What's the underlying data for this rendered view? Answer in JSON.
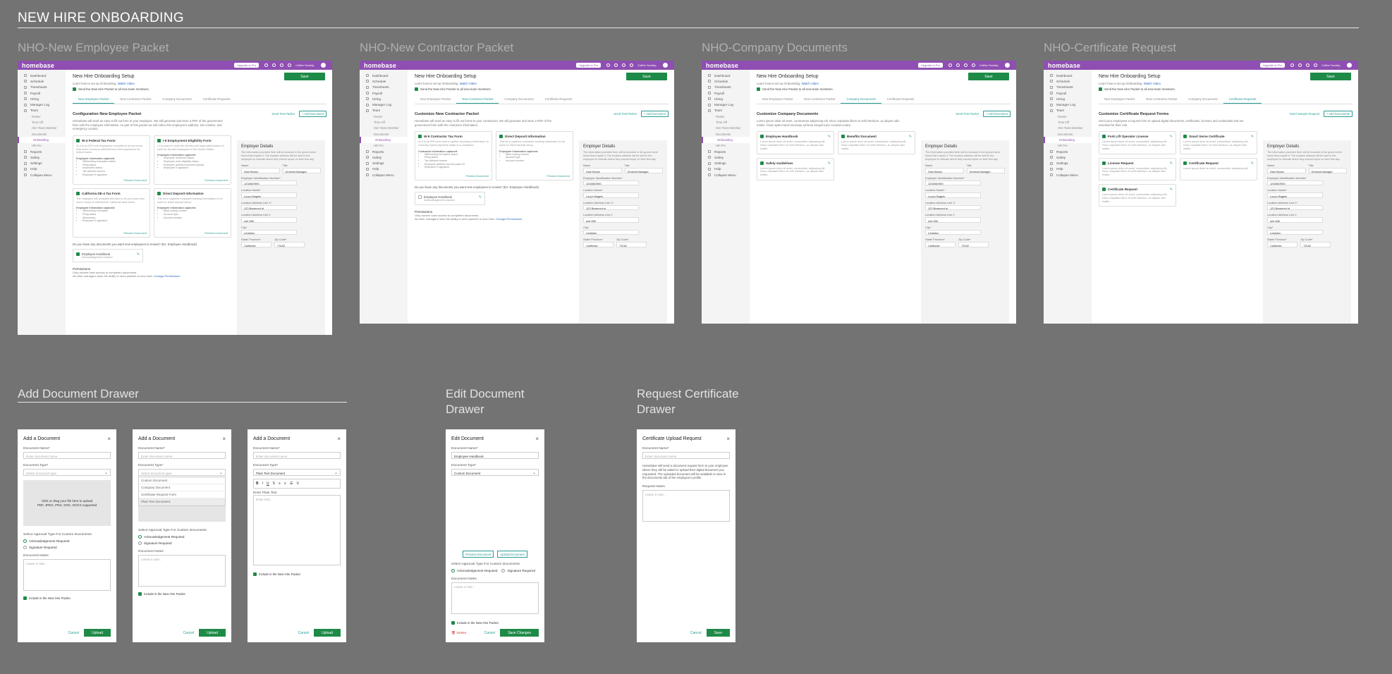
{
  "page_title": "NEW HIRE ONBOARDING",
  "colors": {
    "brand": "#8f4fb2",
    "primary": "#1e8a48",
    "link": "#2a9c95",
    "danger": "#d14a3b",
    "canvas": "#737373"
  },
  "sections": {
    "nho_employee": "NHO-New Employee Packet",
    "nho_contractor": "NHO-New Contractor Packet",
    "nho_company": "NHO-Company Documents",
    "nho_certificate": "NHO-Certificate Request",
    "add_doc": "Add Document Drawer",
    "edit_doc": "Edit Document Drawer",
    "request_cert": "Request Certificate Drawer"
  },
  "app": {
    "logo": "homebase",
    "upgrade": "Upgrade to Pro",
    "account": "Coffee Society..",
    "icons": [
      "clock-icon",
      "chat-icon",
      "bell-icon",
      "help-icon"
    ],
    "nav": [
      {
        "label": "Dashboard",
        "icon": "dashboard-icon"
      },
      {
        "label": "Schedule",
        "icon": "calendar-icon"
      },
      {
        "label": "Timesheets",
        "icon": "clock-icon"
      },
      {
        "label": "Payroll",
        "icon": "dollar-icon"
      },
      {
        "label": "Hiring",
        "icon": "briefcase-icon"
      },
      {
        "label": "Manager Log",
        "icon": "book-icon"
      },
      {
        "label": "Team",
        "icon": "team-icon"
      }
    ],
    "team_sub": [
      "Roster",
      "Time Off",
      "Hire Team Member",
      "Documents",
      "Onboarding",
      "HR Pro"
    ],
    "nav2": [
      {
        "label": "Reports",
        "icon": "chart-icon"
      },
      {
        "label": "Safety",
        "icon": "shield-icon"
      },
      {
        "label": "Settings",
        "icon": "gear-icon"
      },
      {
        "label": "Help",
        "icon": "help-icon"
      },
      {
        "label": "Collapse Menu",
        "icon": "collapse-icon"
      }
    ],
    "title": "New Hire Onboarding Setup",
    "save": "Save",
    "learn": "Learn how to set up Onboarding.",
    "watch": "Watch Video",
    "send_new": "Send the New Hire Packet to all new team members.",
    "tabs": [
      "New Employee Packet",
      "New Contractor Packet",
      "Company Documents",
      "Certificate Requests"
    ],
    "send_test": "Send Test Packet",
    "add_document": "+ Add Document",
    "send_sample": "Send Sample Request",
    "add_documents": "+ Add Documents",
    "preview": "Preview Document",
    "docs_question": "Do you have any documents you want new employees to review? (Ex: Employee Handbook)",
    "docs_question_c": "Do you have any documents you want new employees to review? (Ex: Employee Handbook)",
    "handbook": "Employee Handbook",
    "ack": "Acknowledgement required",
    "perm_h": "Permissions",
    "perm_1": "Only owners have access to completed documents.",
    "perm_2": "All other managers have the ability to send packets to new hires.",
    "change_perm": "Change Permissions",
    "employer": {
      "title": "Employer Details",
      "desc": "The information provided here will be included in the government forms that require it. The location address will be sent to the employee to indicate where they should report on their first day.",
      "name_l": "Name",
      "name": "Sam Brown",
      "title_l": "Title",
      "title_v": "General Manager",
      "ein_l": "Employer Identification Number*",
      "ein": "1234567890",
      "loc_l": "Location Name*",
      "loc": "Lucy's Bagels",
      "a1_l": "Location Address Line 1*",
      "a1": "123 Bowmont st",
      "a2_l": "Location Address Line 2",
      "a2": "unit 456",
      "city_l": "City*",
      "city": "Lewiston",
      "state_l": "State/ Province*",
      "state": "California",
      "zip_l": "Zip Code*",
      "zip": "73162"
    },
    "emp_packet": {
      "h": "Configuration New Employee Packet",
      "desc": "Homebase will send an easy to fill out form to your employee. We will generate and store a PDF of the government form with the employee information. As part of this packet we will collect the employee's address, ssn number, and emergency contact.",
      "cards": [
        {
          "t": "W-4 Federal Tax Form",
          "d": "W-4 is an IRS form employees complete to let you know how much money to withhold from their paychecks for federal taxes.",
          "h": "Employee Information captured:",
          "items": [
            "Withholding exemption status",
            "Filing status",
            "Dependent status",
            "Tax withheld income",
            "Employee E-signature"
          ]
        },
        {
          "t": "I-9 Employment Eligibility Form",
          "d": "I-9 is used to verify the identity and legal authorization to work for all paid employees in the United States.",
          "h": "Employee Information captured:",
          "items": [
            "Employee residence status",
            "Employee work eligibility status",
            "Employee identity document upload",
            "Employee E-signature"
          ]
        },
        {
          "t": "California DE-4 Tax Form",
          "d": "The employee will complete this form to let you know how much money to withhold for California state taxes.",
          "h": "Employee Information captured:",
          "items": [
            "Withholding exemption",
            "Filing status",
            "Allowances",
            "Employee E-signature"
          ]
        },
        {
          "t": "Direct Deposit Information",
          "d": "This form captures employee banking information to be used for direct deposit setup.",
          "h": "Employee Information captured:",
          "items": [
            "Bank routing number",
            "Account type",
            "Account number"
          ]
        }
      ]
    },
    "con_packet": {
      "h": "Customize New Contractor Packet",
      "desc": "Homebase will send an easy to fill out forms to your contractors. We will generate and store a PDF of the government form with the contractor information.",
      "cards": [
        {
          "t": "W-9 Contractor Tax Form",
          "d": "W-9 is an IRS form used to gather necessary information to correctly report payments made to a contractor.",
          "h": "Contractor Information captured:",
          "items": [
            "Withholding exemption status",
            "Filing status",
            "Tax withheld income",
            "Employee address and tax payer ID",
            "Employee E-signature"
          ]
        },
        {
          "t": "Direct Deposit Information",
          "d": "This form captures contractor banking information to be used for direct deposit setup.",
          "h": "Employee Information captured:",
          "items": [
            "Bank routing number",
            "Account type",
            "Account number"
          ]
        }
      ]
    },
    "company": {
      "h": "Customize Company Documents",
      "desc": "Lorem ipsum dolor sit amet, consectetur adipiscing elit. Nunc vulputate libero et velit interdum, ac aliquet odio mattis. Class aptent taciti sociosqu ad litora torquent per conubia nostra.",
      "cards": [
        {
          "t": "Employee Handbook",
          "d": "Lorem ipsum dolor sit amet, consectetur adipiscing elit. Nunc vulputate libero et velit interdum, ac aliquet odio mattis."
        },
        {
          "t": "Benefits Document",
          "d": "Lorem ipsum dolor sit amet, consectetur adipiscing elit. Nunc vulputate libero et velit interdum, ac aliquet odio mattis."
        },
        {
          "t": "Safety Guidelines",
          "d": "Lorem ipsum dolor sit amet, consectetur adipiscing elit. Nunc vulputate libero et velit interdum, ac aliquet odio mattis."
        }
      ]
    },
    "cert": {
      "h": "Customize Certificate Request Forms",
      "desc": "Send your employees a request form to upload digital documents, certificates, licenses and credentials that are essential for their role.",
      "cards": [
        {
          "t": "Fork Lift Operator License",
          "d": "Lorem ipsum dolor sit amet, consectetur adipiscing elit. Nunc vulputate libero et velit interdum, ac aliquet odio mattis."
        },
        {
          "t": "Smart Serve Certificate",
          "d": "Lorem ipsum dolor sit amet, consectetur adipiscing elit. Nunc vulputate libero et velit interdum, ac aliquet odio mattis."
        },
        {
          "t": "License Request",
          "d": "Lorem ipsum dolor sit amet, consectetur adipiscing elit. Nunc vulputate libero et velit interdum, ac aliquet odio mattis."
        },
        {
          "t": "Certificate Request",
          "d": "Lorem ipsum dolor sit amet, consectetur adipiscing elit."
        },
        {
          "t": "Certificate Request",
          "d": "Lorem ipsum dolor sit amet, consectetur adipiscing elit. Nunc vulputate libero et velit interdum, ac aliquet odio mattis."
        }
      ]
    }
  },
  "drawer": {
    "add_title": "Add a Document",
    "edit_title": "Edit Document",
    "cert_title": "Certificate Upload Request",
    "name_l": "Document Name*",
    "name_ph": "Enter document name",
    "name_val": "Employee Handbook",
    "type_l": "Document Type*",
    "type_ph": "Select document type",
    "type_text": "Plain Text Document",
    "type_custom": "Custom Document",
    "type_opts": [
      "Custom Document",
      "Company Document",
      "Certificate Request Form",
      "Plain Text Document"
    ],
    "drop1": "Click or drag your file here to upload",
    "drop2": "PDF, JPEG, PNG, DOC, DOCX supported",
    "approval_l": "Select Approval Type For Custom Documents",
    "ack": "Acknowledgement Required",
    "sig": "Signature Required",
    "notes_l": "Document Notes",
    "notes_ph": "Leave a note...",
    "include": "Include in the New Hire Packet",
    "cancel": "Cancel",
    "upload": "Upload",
    "save_changes": "Save Changes",
    "save": "Save",
    "delete": "Delete",
    "plain_l": "Enter Plain Text",
    "plain_ph": "Enter text...",
    "preview": "Preview Document",
    "upload_doc": "Upload Document",
    "cert_desc": "Homebase will send a document request form to your employee where they will be asked to upload their digital document you requested. The uploaded document will be available to view in the documents tab of the employee's profile.",
    "req_notes_l": "Request Notes"
  }
}
